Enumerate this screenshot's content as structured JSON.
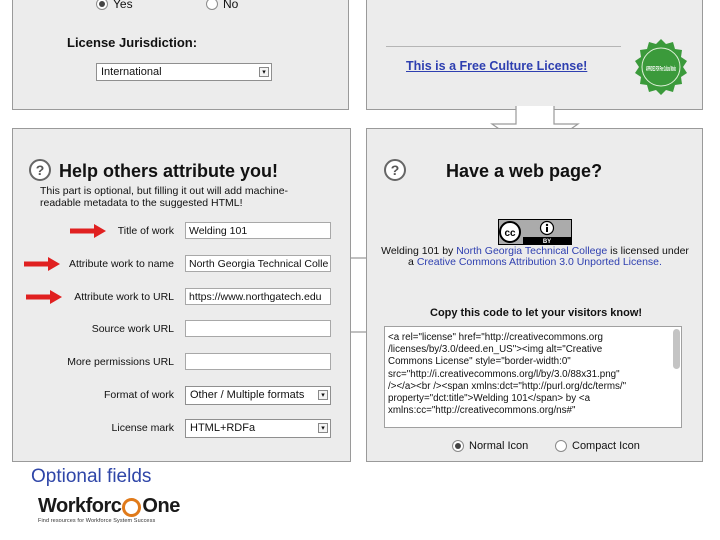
{
  "top_left": {
    "yes_label": "Yes",
    "no_label": "No",
    "jurisdiction_label": "License Jurisdiction:",
    "jurisdiction_value": "International"
  },
  "top_right": {
    "free_culture_text": "This is a Free Culture License!",
    "badge_text": "APPROVED FOR Free Cultural Works"
  },
  "attribution": {
    "title": "Help others attribute you!",
    "description": "This part is optional, but filling it out will add machine-readable metadata to the suggested HTML!",
    "fields": [
      {
        "label": "Title of work",
        "value": "Welding 101",
        "arrow": true
      },
      {
        "label": "Attribute work to name",
        "value": "North Georgia Technical Colle",
        "arrow": true
      },
      {
        "label": "Attribute work to URL",
        "value": "https://www.northgatech.edu",
        "arrow": true
      },
      {
        "label": "Source work URL",
        "value": "",
        "arrow": false
      },
      {
        "label": "More permissions URL",
        "value": "",
        "arrow": false
      },
      {
        "label": "Format of work",
        "value": "Other / Multiple formats",
        "arrow": false
      },
      {
        "label": "License mark",
        "value": "HTML+RDFa",
        "arrow": false
      }
    ],
    "arrow_color": "#e02020"
  },
  "web_page": {
    "title": "Have a web page?",
    "cc_badge": {
      "cc": "cc",
      "by": "BY"
    },
    "license_prefix": "Welding 101 by",
    "license_author": "North Georgia Technical College",
    "license_mid": "is licensed under a",
    "license_name": "Creative Commons Attribution 3.0 Unported License.",
    "copy_label": "Copy this code to let your visitors know!",
    "code_lines": [
      "<a rel=\"license\" href=\"http://creativecommons.org",
      "/licenses/by/3.0/deed.en_US\"><img alt=\"Creative",
      "Commons License\" style=\"border-width:0\"",
      "src=\"http://i.creativecommons.org/l/by/3.0/88x31.png\"",
      "/></a><br /><span xmlns:dct=\"http://purl.org/dc/terms/\"",
      "property=\"dct:title\">Welding 101</span> by <a",
      "xmlns:cc=\"http://creativecommons.org/ns#\""
    ],
    "normal_icon_label": "Normal Icon",
    "compact_icon_label": "Compact Icon",
    "selected_icon": "normal"
  },
  "caption": "Optional fields",
  "logo": {
    "name_left": "Workforc",
    "name_right": "One",
    "tagline": "Find resources for Workforce System Success"
  },
  "colors": {
    "panel_bg": "#ececec",
    "link_blue": "#2e3fb0",
    "caption_blue": "#2f46a8",
    "badge_green": "#3b9a3b",
    "logo_orange": "#e07a1a"
  }
}
